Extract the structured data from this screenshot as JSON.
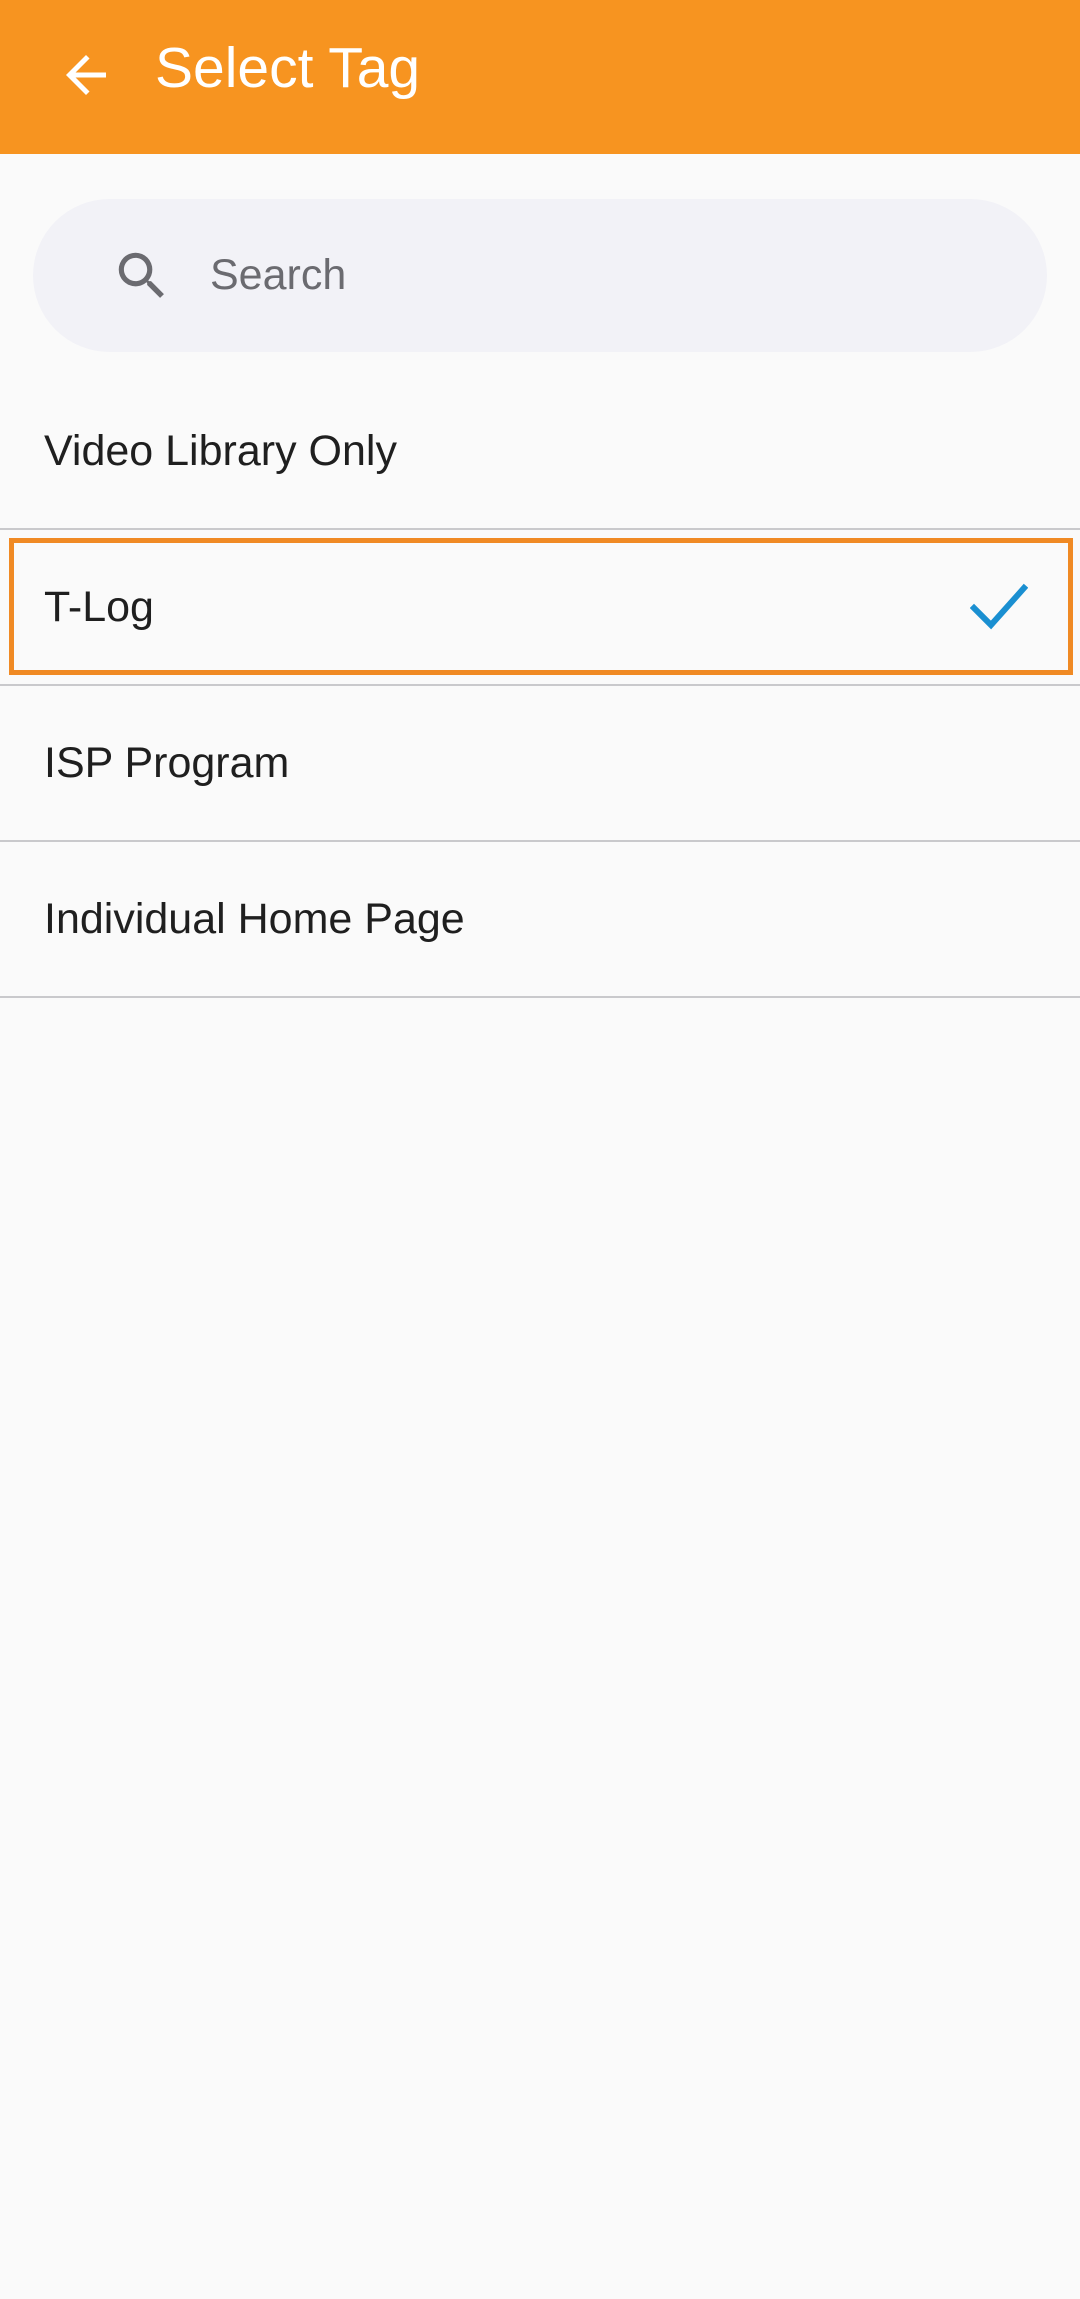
{
  "app_bar": {
    "title": "Select Tag",
    "back_icon": "arrow-left-icon",
    "color": "#f79420"
  },
  "search": {
    "placeholder": "Search",
    "value": "",
    "icon": "search-icon"
  },
  "tags": [
    {
      "label": "Video Library Only",
      "selected": false
    },
    {
      "label": "T-Log",
      "selected": true
    },
    {
      "label": "ISP Program",
      "selected": false
    },
    {
      "label": "Individual Home Page",
      "selected": false
    }
  ],
  "colors": {
    "accent": "#f79420",
    "check": "#1a8fd1",
    "highlight": "#f08a24"
  }
}
